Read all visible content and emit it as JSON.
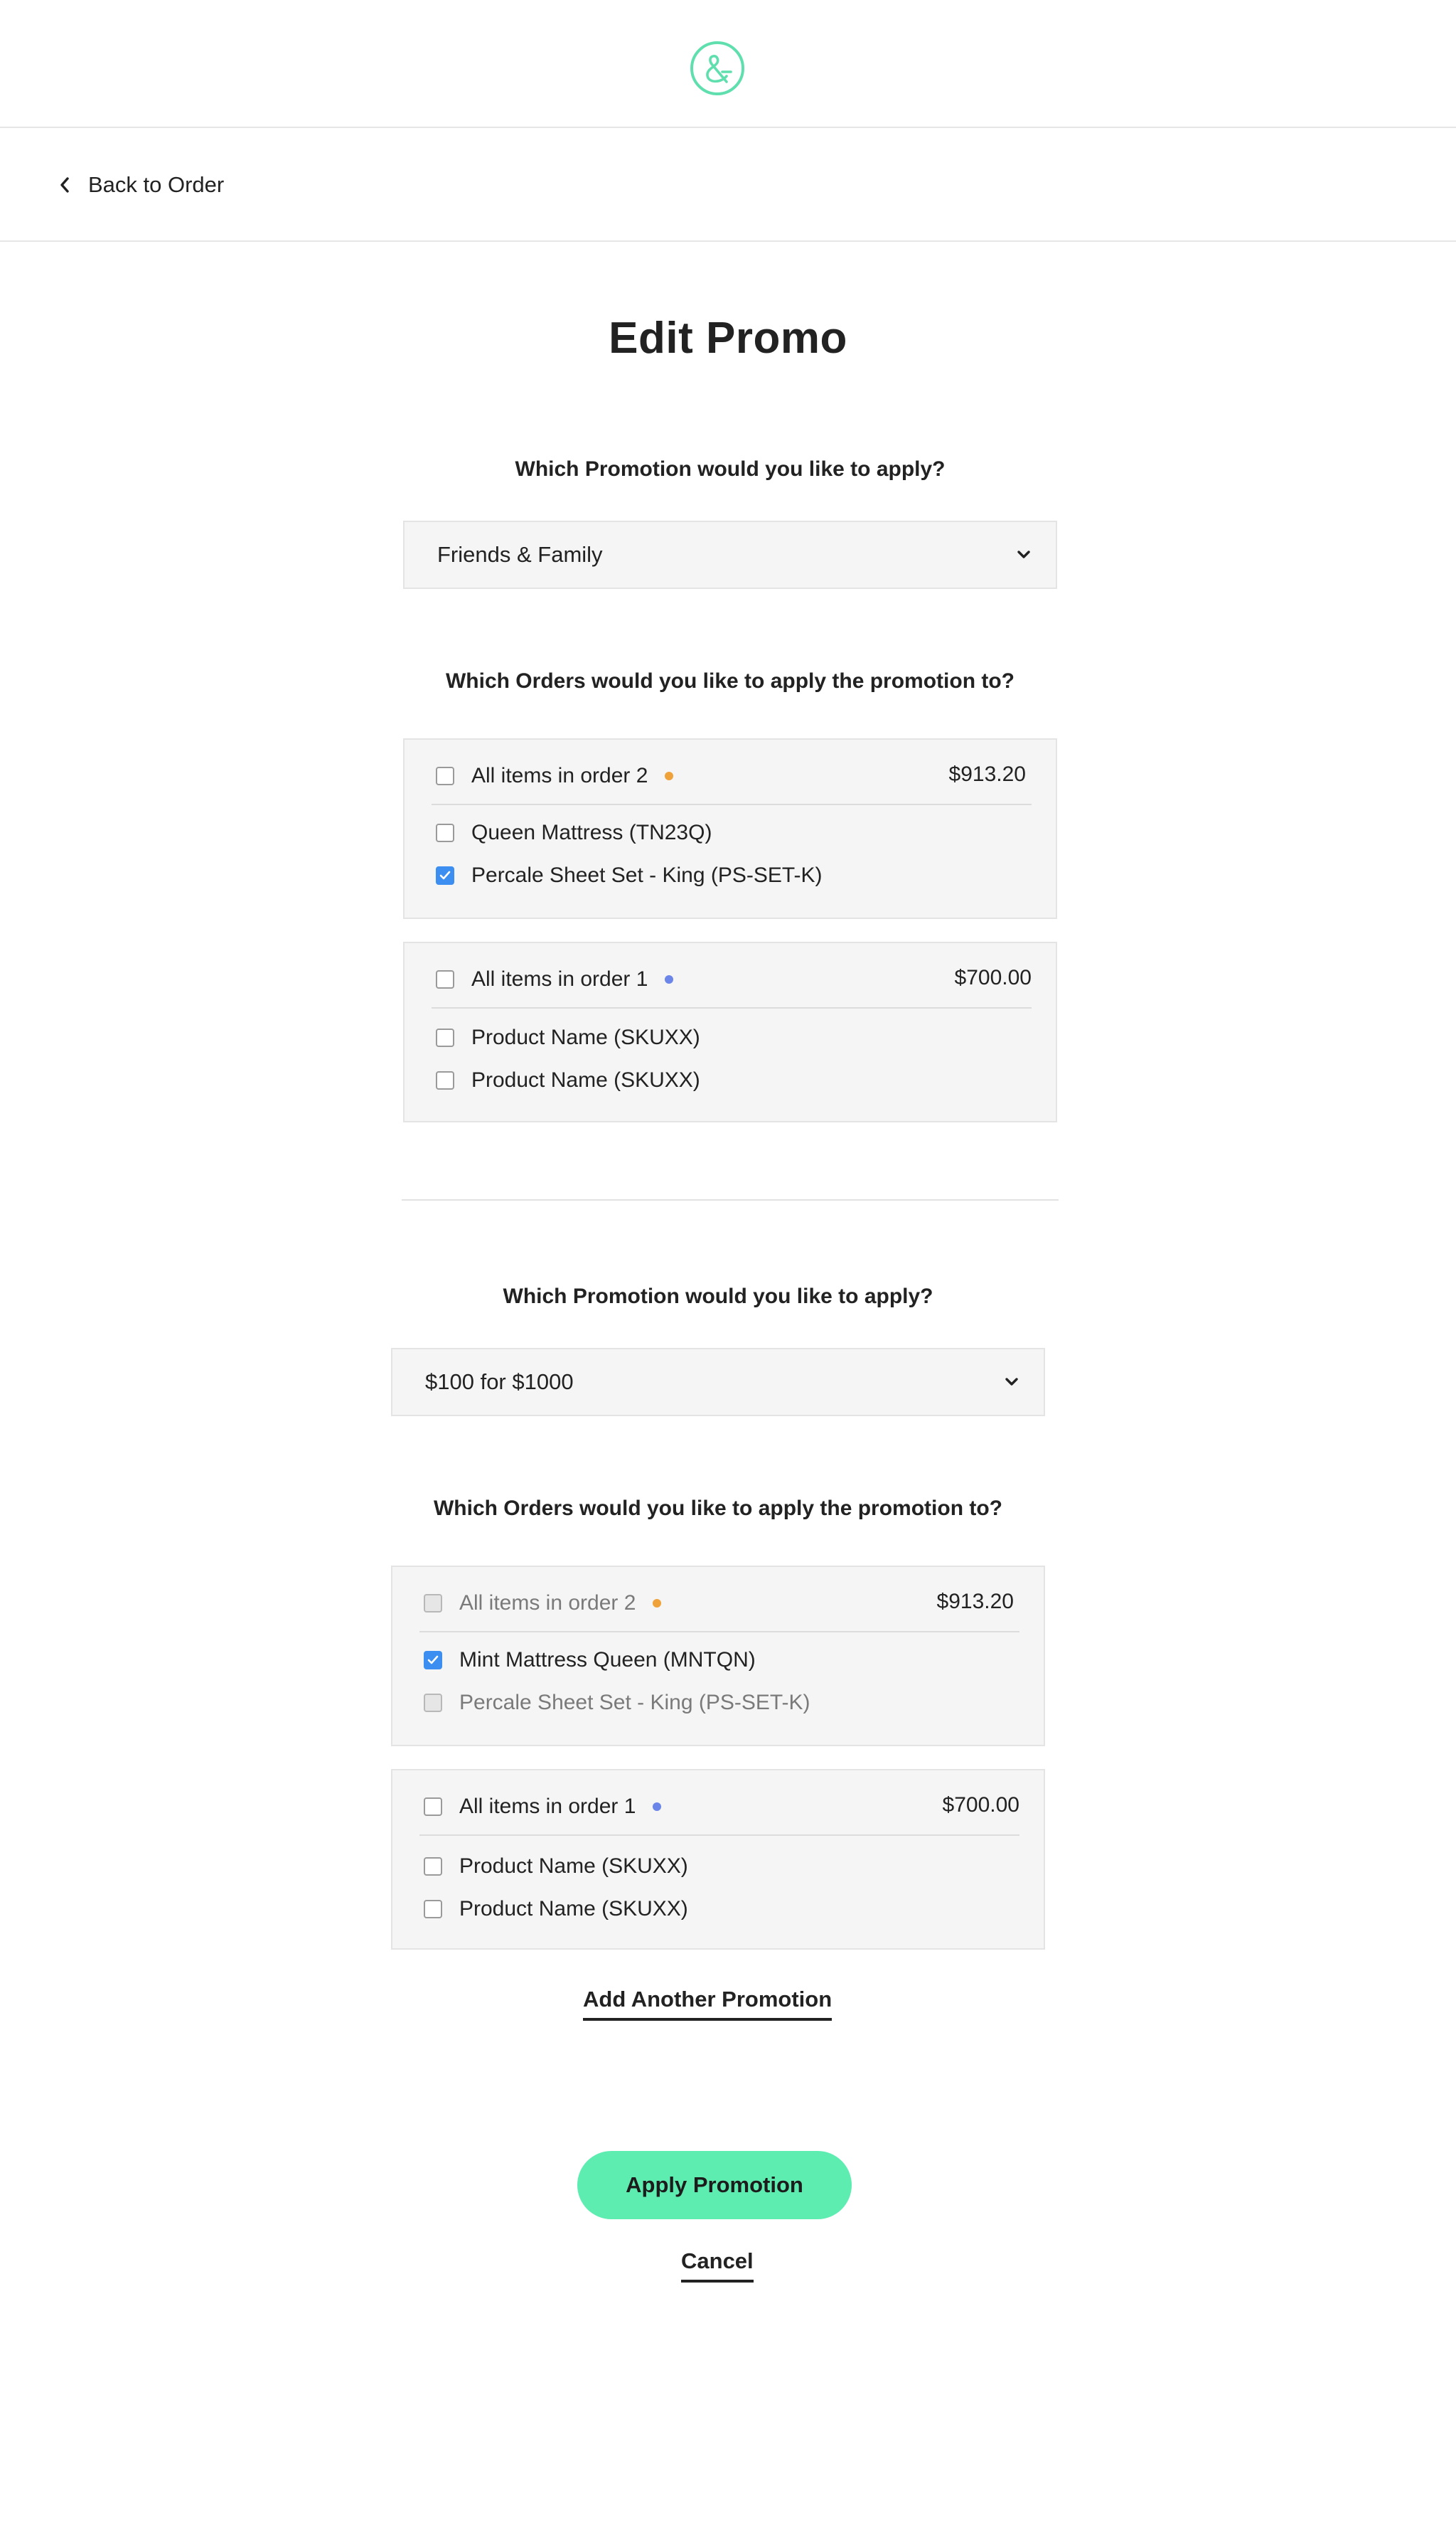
{
  "colors": {
    "accent": "#5eedb1",
    "logo": "#5fdfae",
    "checkbox_checked": "#3c8ef0",
    "order2_dot": "#f0a23a",
    "order1_dot": "#6b86e8"
  },
  "nav": {
    "back_label": "Back to Order",
    "back_icon": "chevron-left-icon",
    "logo_icon": "ampersand-logo"
  },
  "page_title": "Edit Promo",
  "promotions": [
    {
      "question": "Which Promotion would you like to apply?",
      "selected": "Friends & Family",
      "orders_question": "Which Orders would you like to apply the promotion to?",
      "orders": [
        {
          "label": "All items in order 2",
          "price": "$913.20",
          "dot": "orange",
          "checked": false,
          "disabled": false,
          "items": [
            {
              "label": "Queen Mattress  (TN23Q)",
              "checked": false,
              "disabled": false
            },
            {
              "label": "Percale Sheet Set - King (PS-SET-K)",
              "checked": true,
              "disabled": false
            }
          ]
        },
        {
          "label": "All items in order 1",
          "price": "$700.00",
          "dot": "blue",
          "checked": false,
          "disabled": false,
          "items": [
            {
              "label": "Product Name (SKUXX)",
              "checked": false,
              "disabled": false
            },
            {
              "label": "Product Name (SKUXX)",
              "checked": false,
              "disabled": false
            }
          ]
        }
      ]
    },
    {
      "question": "Which Promotion would you like to apply?",
      "selected": "$100 for $1000",
      "orders_question": "Which Orders would you like to apply the promotion to?",
      "orders": [
        {
          "label": "All items in order 2",
          "price": "$913.20",
          "dot": "orange",
          "checked": false,
          "disabled": true,
          "items": [
            {
              "label": "Mint Mattress Queen  (MNTQN)",
              "checked": true,
              "disabled": false
            },
            {
              "label": "Percale Sheet Set - King (PS-SET-K)",
              "checked": false,
              "disabled": true
            }
          ]
        },
        {
          "label": "All items in order 1",
          "price": "$700.00",
          "dot": "blue",
          "checked": false,
          "disabled": false,
          "items": [
            {
              "label": "Product Name (SKUXX)",
              "checked": false,
              "disabled": false
            },
            {
              "label": "Product Name (SKUXX)",
              "checked": false,
              "disabled": false
            }
          ]
        }
      ]
    }
  ],
  "actions": {
    "add_promotion": "Add Another Promotion",
    "apply": "Apply Promotion",
    "cancel": "Cancel"
  }
}
